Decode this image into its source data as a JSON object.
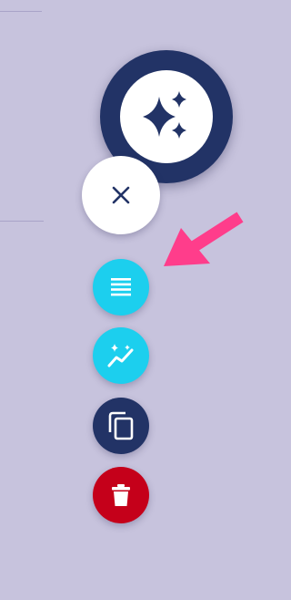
{
  "colors": {
    "background": "#c7c3dd",
    "navy": "#223366",
    "cyan": "#1ccfee",
    "red": "#c5001a",
    "white": "#ffffff",
    "arrow": "#ff3d8b"
  },
  "fab_menu": {
    "main": {
      "icon": "sparkles-icon"
    },
    "actions": [
      {
        "name": "close",
        "icon": "close-icon"
      },
      {
        "name": "list",
        "icon": "list-icon"
      },
      {
        "name": "trend",
        "icon": "trending-sparkle-icon"
      },
      {
        "name": "copy",
        "icon": "copy-icon"
      },
      {
        "name": "delete",
        "icon": "trash-icon"
      }
    ]
  },
  "annotation": {
    "icon": "pointer-arrow-icon",
    "target": "list"
  }
}
